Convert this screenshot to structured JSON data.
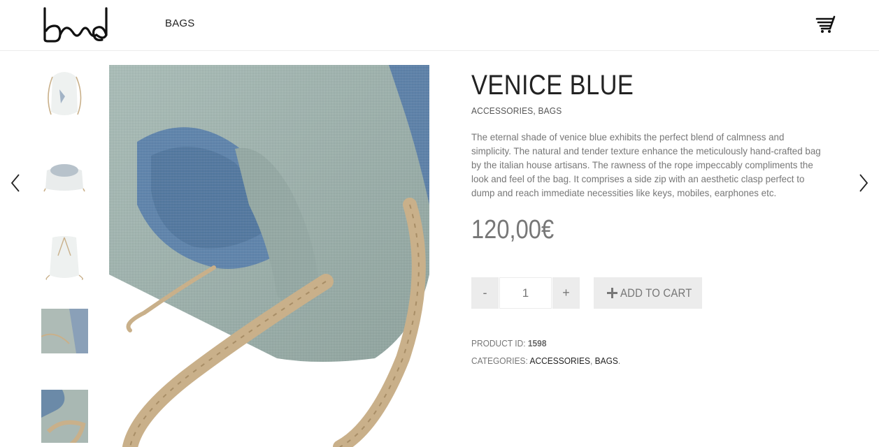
{
  "header": {
    "logo_alt": "band",
    "nav": [
      {
        "label": "BAGS"
      }
    ]
  },
  "gallery": {
    "thumbnails": [
      {
        "name": "thumb-front"
      },
      {
        "name": "thumb-open"
      },
      {
        "name": "thumb-back"
      },
      {
        "name": "thumb-fabric"
      },
      {
        "name": "thumb-rope-detail"
      }
    ]
  },
  "product": {
    "title": "VENICE BLUE",
    "categories_line": "ACCESSORIES, BAGS",
    "description": "The eternal shade of venice blue exhibits the perfect blend of calmness and simplicity. The natural and tender texture enhance the meticulously hand-crafted bag by the italian house artisans. The rawness of the rope impeccably compliments the look and feel of the bag. It comprises a side zip with an aesthetic clasp perfect to dump and reach immediate necessities like keys, mobiles, earphones etc.",
    "price": "120,00€",
    "quantity": {
      "minus": "-",
      "value": "1",
      "plus": "+"
    },
    "add_to_cart": "ADD TO CART",
    "meta": {
      "id_label": "PRODUCT ID:",
      "id_value": "1598",
      "categories_label": "CATEGORIES:",
      "categories": [
        "ACCESSORIES",
        "BAGS"
      ],
      "separator": ",",
      "end": "."
    }
  },
  "colors": {
    "bag": "#9fb3ae",
    "lining": "#5a7ea6",
    "rope": "#c9b08a",
    "button_bg": "#ececec",
    "text_muted": "#777777"
  }
}
